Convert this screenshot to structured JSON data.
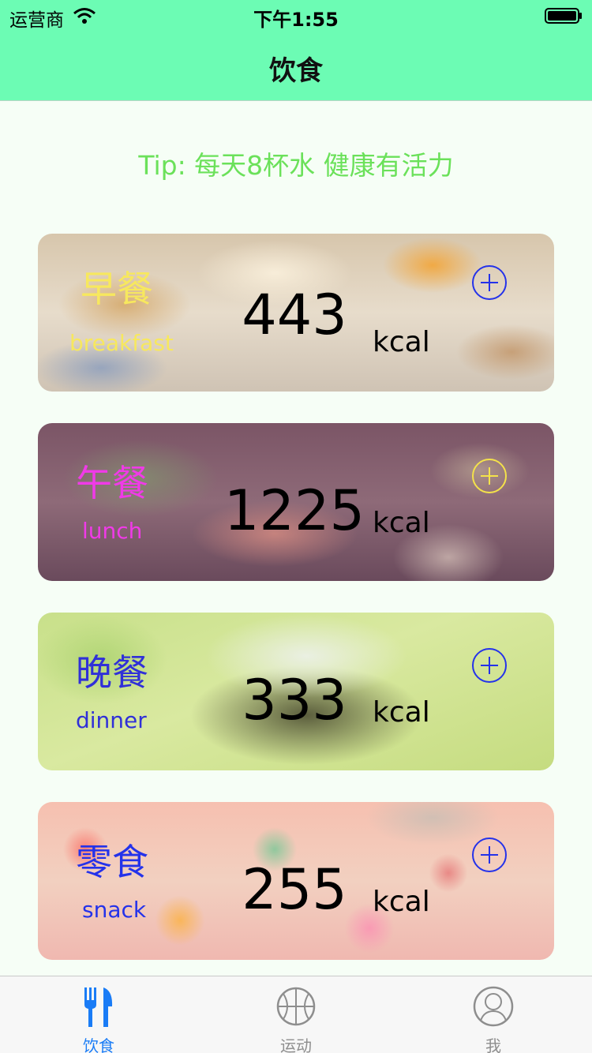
{
  "status_bar": {
    "carrier": "运营商",
    "time": "下午1:55"
  },
  "nav": {
    "title": "饮食"
  },
  "tip": "Tip: 每天8杯水 健康有活力",
  "meals": [
    {
      "name_cn": "早餐",
      "name_en": "breakfast",
      "kcal": "443",
      "unit": "kcal",
      "label_color": "#f7e85e",
      "add_color": "#2432ea"
    },
    {
      "name_cn": "午餐",
      "name_en": "lunch",
      "kcal": "1225",
      "unit": "kcal",
      "label_color": "#f03ae8",
      "add_color": "#f4e24a"
    },
    {
      "name_cn": "晚餐",
      "name_en": "dinner",
      "kcal": "333",
      "unit": "kcal",
      "label_color": "#3030d8",
      "add_color": "#2432ea"
    },
    {
      "name_cn": "零食",
      "name_en": "snack",
      "kcal": "255",
      "unit": "kcal",
      "label_color": "#2432ea",
      "add_color": "#2432ea"
    }
  ],
  "tabs": [
    {
      "label": "饮食",
      "icon": "fork-knife-icon",
      "active": true
    },
    {
      "label": "运动",
      "icon": "basketball-icon",
      "active": false
    },
    {
      "label": "我",
      "icon": "profile-icon",
      "active": false
    }
  ],
  "colors": {
    "accent": "#6cfcb4",
    "tab_active": "#1a7cf6",
    "tab_inactive": "#8e8e8e",
    "tip": "#6be15a"
  }
}
